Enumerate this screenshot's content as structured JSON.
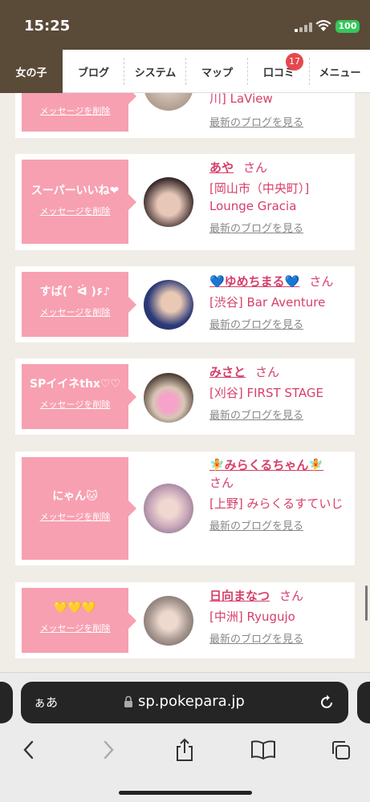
{
  "status_bar": {
    "time": "15:25",
    "battery": "100"
  },
  "nav": {
    "tabs": [
      {
        "label": "女の子",
        "active": true
      },
      {
        "label": "ブログ"
      },
      {
        "label": "システム"
      },
      {
        "label": "マップ"
      },
      {
        "label": "口コミ",
        "badge": "17"
      },
      {
        "label": "メニュー"
      }
    ]
  },
  "cards": [
    {
      "message": "",
      "delete_label": "メッセージを削除",
      "name": "",
      "san": "",
      "shop": "川] LaView",
      "blog_label": "最新のブログを見る"
    },
    {
      "message": "スーパーいいね❤",
      "delete_label": "メッセージを削除",
      "name": "あや",
      "san": "さん",
      "shop": "[岡山市（中央町）] Lounge Gracia",
      "blog_label": "最新のブログを見る"
    },
    {
      "message": "すば(ˆ ᐛ )۶♪",
      "delete_label": "メッセージを削除",
      "name": "💙ゆめちまる💙",
      "san": "さん",
      "shop": "[渋谷] Bar Aventure",
      "blog_label": "最新のブログを見る"
    },
    {
      "message": "SPイイネthx♡♡",
      "delete_label": "メッセージを削除",
      "name": "みさと",
      "san": "さん",
      "shop": "[刈谷] FIRST STAGE",
      "blog_label": "最新のブログを見る"
    },
    {
      "message": "にゃん🐱",
      "delete_label": "メッセージを削除",
      "name": "🧚みらくるちゃん🧚",
      "san": "さん",
      "shop": "[上野] みらくるすていじ",
      "blog_label": "最新のブログを見る"
    },
    {
      "message": "💛💛💛",
      "delete_label": "メッセージを削除",
      "name": "日向まなつ",
      "san": "さん",
      "shop": "[中洲] Ryugujo",
      "blog_label": "最新のブログを見る"
    }
  ],
  "browser": {
    "aa_label": "ぁあ",
    "domain": "sp.pokepara.jp"
  },
  "colors": {
    "accent_pink": "#f7a0b1",
    "name_pink": "#d63f69",
    "nav_brown": "#5a4a38"
  }
}
